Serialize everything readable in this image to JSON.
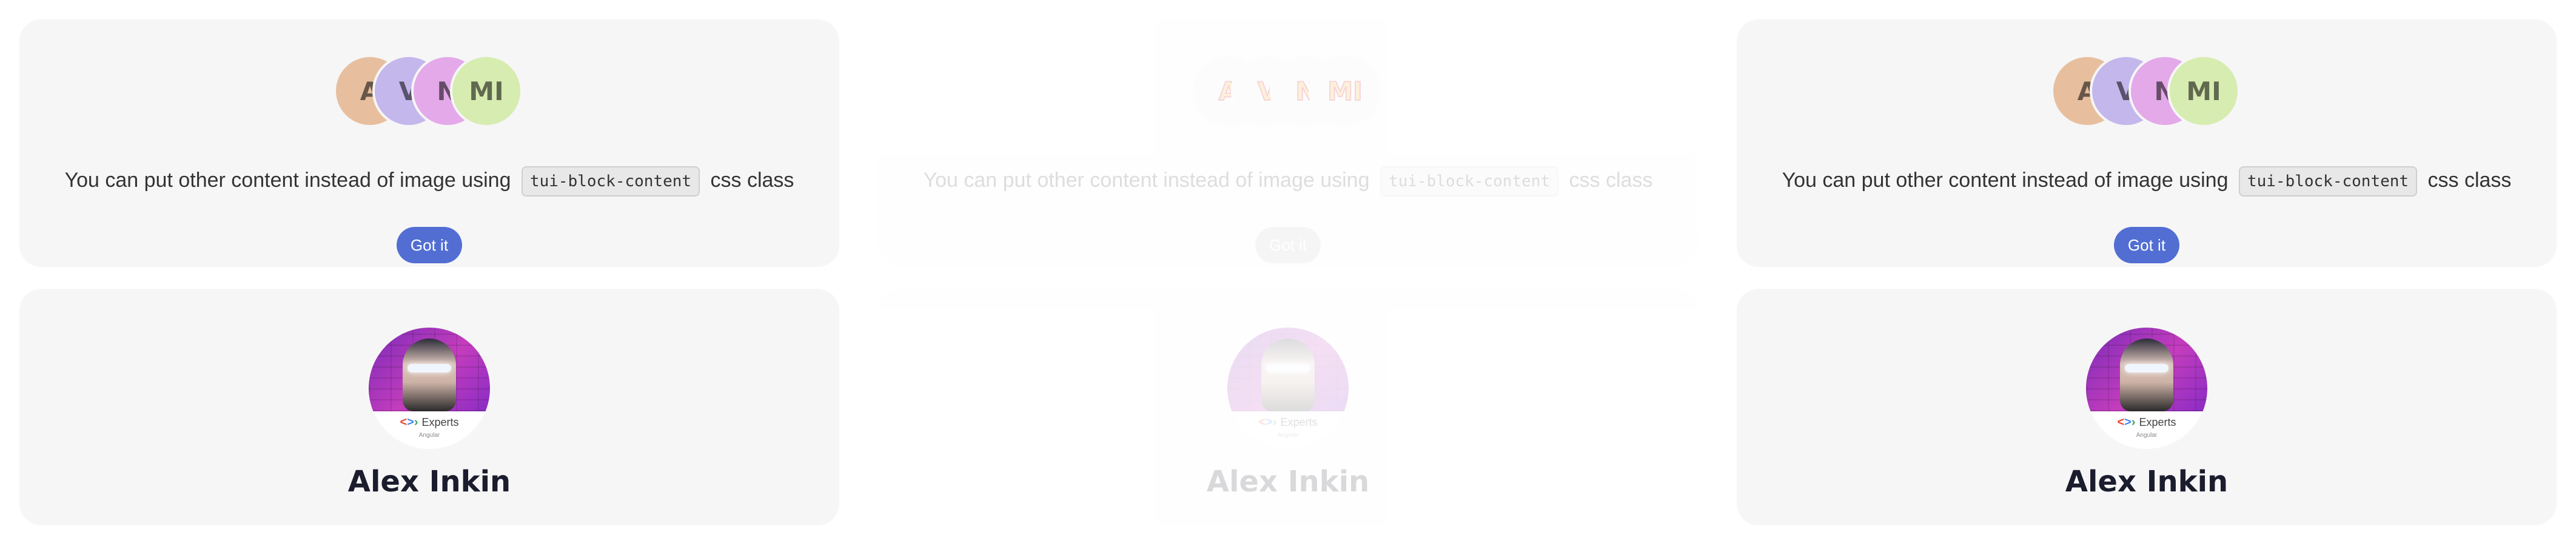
{
  "avatars": [
    "A",
    "V",
    "N",
    "MI"
  ],
  "hint": {
    "before": "You can put other content instead of image using",
    "code": "tui-block-content",
    "after": "css class"
  },
  "button_label": "Got it",
  "profile": {
    "name": "Alex Inkin",
    "badge_text": "Experts",
    "badge_sub": "Angular"
  },
  "colors": {
    "button": "#526ed3",
    "card_background": "#f6f6f6",
    "avatar_a": "#e7bf9f",
    "avatar_v": "#c4b7ec",
    "avatar_n": "#e4a9e9",
    "avatar_mi": "#d7ecb0"
  }
}
